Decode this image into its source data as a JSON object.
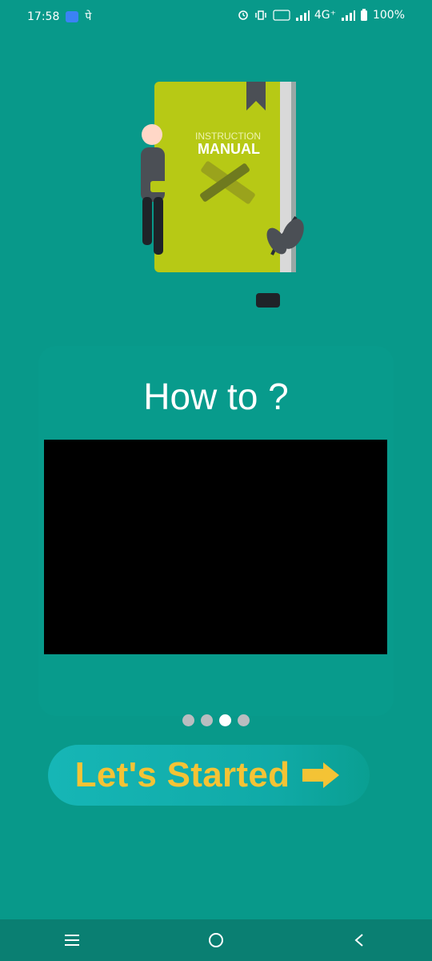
{
  "status": {
    "time": "17:58",
    "left_extra": "पे",
    "network": "4G⁺",
    "battery": "100%"
  },
  "hero": {
    "manual_top": "INSTRUCTION",
    "manual_bottom": "MANUAL"
  },
  "title": "How to ?",
  "pager": {
    "count": 4,
    "active_index": 2
  },
  "start_button": {
    "label": "Let's Started"
  },
  "colors": {
    "background": "#08998a",
    "button_text": "#f4c335",
    "book": "#b7c915"
  },
  "icons": {
    "nav_menu": "menu-icon",
    "nav_home": "home-icon",
    "nav_back": "back-icon"
  }
}
